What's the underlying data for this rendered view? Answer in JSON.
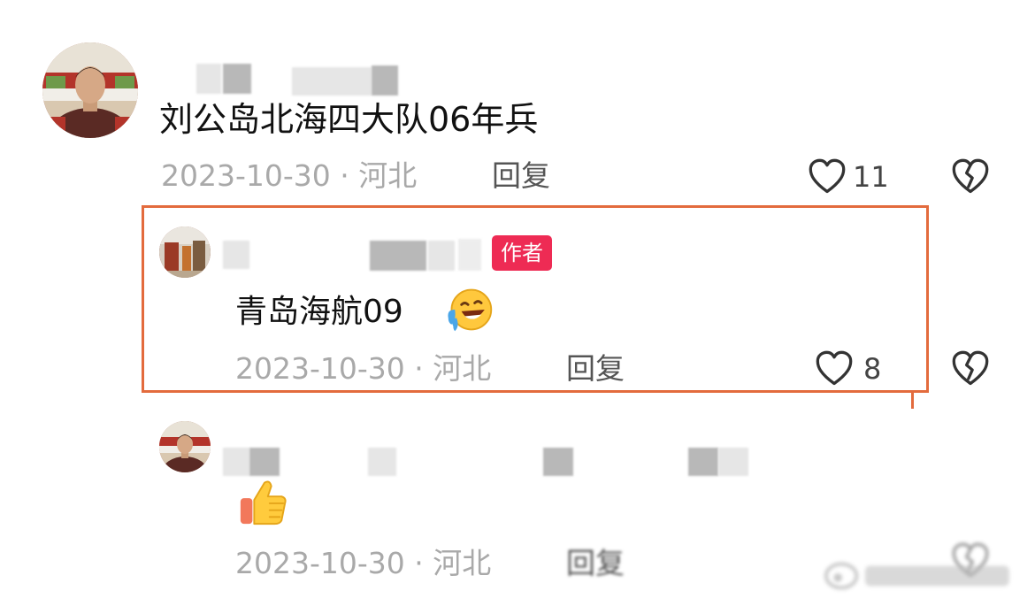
{
  "comments": [
    {
      "text": "刘公岛北海四大队06年兵",
      "date_location": "2023-10-30 · 河北",
      "reply_label": "回复",
      "likes": "11"
    },
    {
      "badge": "作者",
      "text": "青岛海航09",
      "date_location": "2023-10-30 · 河北",
      "reply_label": "回复",
      "likes": "8"
    },
    {
      "date_location": "2023-10-30 · 河北",
      "reply_label": "回复"
    }
  ],
  "icons": {
    "like": "heart-outline-icon",
    "dislike": "broken-heart-icon",
    "emoji": "laughing-tears-emoji",
    "thumbs_up": "thumbs-up-emoji"
  },
  "colors": {
    "highlight_border": "#e36b3d",
    "author_badge": "#ee2b54",
    "meta_text": "#a9a9a9"
  }
}
